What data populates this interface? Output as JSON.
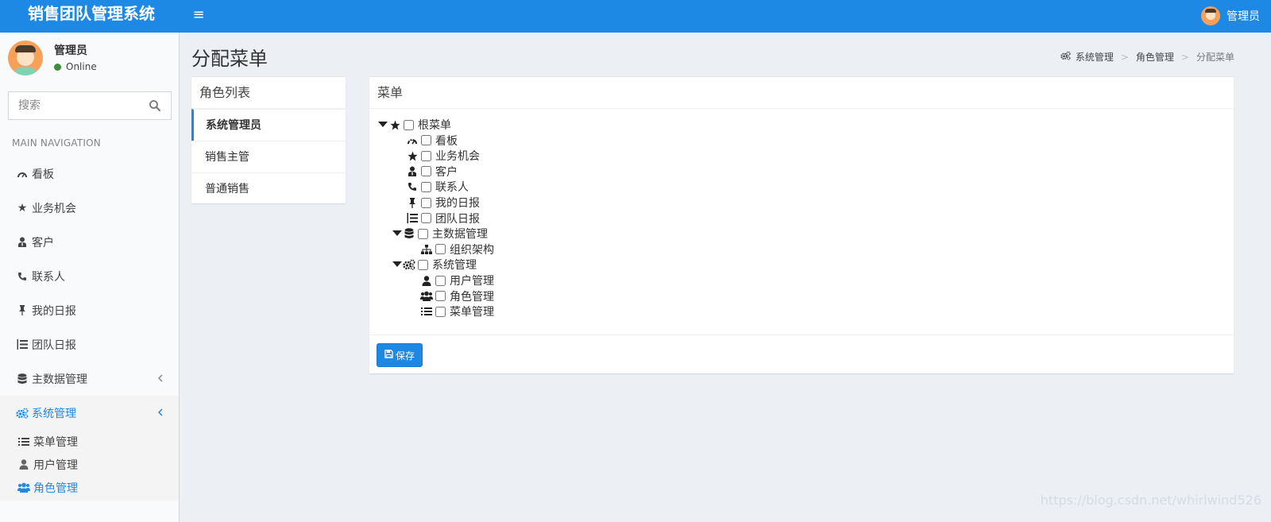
{
  "header": {
    "logo": "销售团队管理系统",
    "user_name": "管理员"
  },
  "sidebar": {
    "user": {
      "name": "管理员",
      "status": "Online"
    },
    "search": {
      "placeholder": "搜索"
    },
    "nav_header": "MAIN NAVIGATION",
    "items": [
      {
        "label": "看板",
        "icon": "dashboard-icon"
      },
      {
        "label": "业务机会",
        "icon": "star-icon"
      },
      {
        "label": "客户",
        "icon": "user-tie-icon"
      },
      {
        "label": "联系人",
        "icon": "phone-icon"
      },
      {
        "label": "我的日报",
        "icon": "pin-icon"
      },
      {
        "label": "团队日报",
        "icon": "list-ol-icon"
      },
      {
        "label": "主数据管理",
        "icon": "database-icon"
      },
      {
        "label": "系统管理",
        "icon": "cogs-icon"
      }
    ],
    "sub_items": [
      {
        "label": "菜单管理",
        "icon": "list-icon"
      },
      {
        "label": "用户管理",
        "icon": "user-icon"
      },
      {
        "label": "角色管理",
        "icon": "users-icon"
      }
    ]
  },
  "page": {
    "title": "分配菜单",
    "breadcrumb": [
      "系统管理",
      "角色管理",
      "分配菜单"
    ]
  },
  "roles": {
    "title": "角色列表",
    "items": [
      "系统管理员",
      "销售主管",
      "普通销售"
    ],
    "selected": "系统管理员"
  },
  "menu": {
    "title": "菜单",
    "tree": [
      {
        "label": "根菜单",
        "icon": "star-icon",
        "level": 0,
        "expanded": true,
        "checked": false
      },
      {
        "label": "看板",
        "icon": "dashboard-icon",
        "level": 1,
        "checked": false
      },
      {
        "label": "业务机会",
        "icon": "star-icon",
        "level": 1,
        "checked": false
      },
      {
        "label": "客户",
        "icon": "user-tie-icon",
        "level": 1,
        "checked": false
      },
      {
        "label": "联系人",
        "icon": "phone-icon",
        "level": 1,
        "checked": false
      },
      {
        "label": "我的日报",
        "icon": "pin-icon",
        "level": 1,
        "checked": false
      },
      {
        "label": "团队日报",
        "icon": "list-ol-icon",
        "level": 1,
        "checked": false
      },
      {
        "label": "主数据管理",
        "icon": "database-icon",
        "level": 1,
        "expanded": true,
        "checked": false
      },
      {
        "label": "组织架构",
        "icon": "sitemap-icon",
        "level": 2,
        "checked": false
      },
      {
        "label": "系统管理",
        "icon": "cogs-icon",
        "level": 1,
        "expanded": true,
        "checked": false
      },
      {
        "label": "用户管理",
        "icon": "user-icon",
        "level": 2,
        "checked": false
      },
      {
        "label": "角色管理",
        "icon": "users-icon",
        "level": 2,
        "checked": false
      },
      {
        "label": "菜单管理",
        "icon": "list-icon",
        "level": 2,
        "checked": false
      }
    ],
    "save_label": "保存"
  },
  "watermark": "https://blog.csdn.net/whirlwind526",
  "colors": {
    "primary": "#1e88e5",
    "sidebar_bg": "#f9fafc",
    "content_bg": "#ecf0f5"
  }
}
